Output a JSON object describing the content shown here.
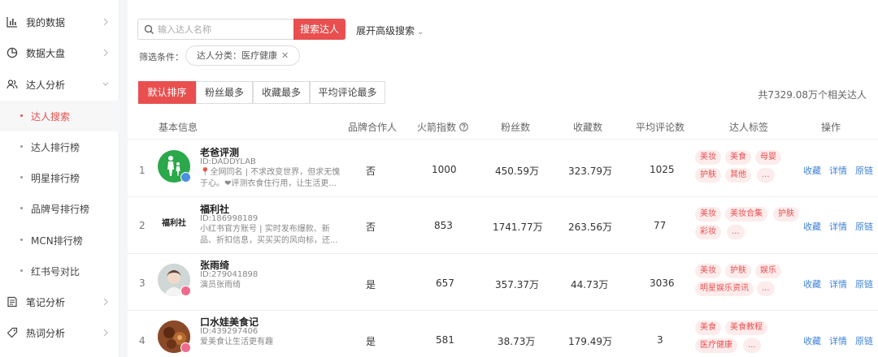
{
  "sidebar": {
    "items": [
      {
        "label": "我的数据",
        "icon": "bar-chart-icon"
      },
      {
        "label": "数据大盘",
        "icon": "pie-chart-icon"
      },
      {
        "label": "达人分析",
        "icon": "users-icon"
      },
      {
        "label": "笔记分析",
        "icon": "note-icon"
      },
      {
        "label": "热词分析",
        "icon": "tag-icon"
      }
    ],
    "sub_items": [
      {
        "label": "达人搜索",
        "active": true
      },
      {
        "label": "达人排行榜"
      },
      {
        "label": "明星排行榜"
      },
      {
        "label": "品牌号排行榜"
      },
      {
        "label": "MCN排行榜"
      },
      {
        "label": "红书号对比"
      }
    ]
  },
  "search": {
    "placeholder": "输入达人名称",
    "button": "搜索达人",
    "advanced": "展开高级搜索",
    "advanced_icon": "chevron-down-icon"
  },
  "filter": {
    "label": "筛选条件：",
    "chip": "达人分类：医疗健康",
    "chip_icon": "close-icon"
  },
  "sort_tabs": [
    "默认排序",
    "粉丝最多",
    "收藏最多",
    "平均评论最多"
  ],
  "total": "共7329.08万个相关达人",
  "table": {
    "headers": {
      "basic": "基本信息",
      "brand": "品牌合作人",
      "hot": "火箭指数",
      "fans": "粉丝数",
      "collect": "收藏数",
      "comments": "平均评论数",
      "tags": "达人标签",
      "ops": "操作"
    },
    "help_icon": "question-circle-icon",
    "actions": [
      "收藏",
      "详情",
      "原链"
    ],
    "rows": [
      {
        "index": "1",
        "name": "老爸评测",
        "id": "ID:DADDYLAB",
        "desc1": "📍全网同名 | 不求改变世界，但求无愧",
        "desc2": "于心。❤评测衣食住行用，让生活更...",
        "brand": "否",
        "hot": "1000",
        "fans": "450.59万",
        "collect": "323.79万",
        "comments": "1025",
        "tags": [
          "美妆",
          "美食",
          "母婴",
          "护肤",
          "其他",
          "..."
        ]
      },
      {
        "index": "2",
        "name": "福利社",
        "logo_text": "福利社",
        "id": "ID:186998189",
        "desc1": "小红书官方账号 | 实时发布爆款、新",
        "desc2": "品、折扣信息，买买买的风向标，还...",
        "brand": "否",
        "hot": "853",
        "fans": "1741.77万",
        "collect": "263.56万",
        "comments": "77",
        "tags": [
          "美妆",
          "美妆合集",
          "护肤",
          "彩妆",
          "..."
        ]
      },
      {
        "index": "3",
        "name": "张雨绮",
        "id": "ID:279041898",
        "desc1": "演员张雨绮",
        "desc2": "",
        "brand": "是",
        "hot": "657",
        "fans": "357.37万",
        "collect": "44.73万",
        "comments": "3036",
        "tags": [
          "美妆",
          "护肤",
          "娱乐",
          "明星娱乐资讯",
          "..."
        ]
      },
      {
        "index": "4",
        "name": "口水娃美食记",
        "id": "ID:439297406",
        "desc1": "爱美食让生活更有趣",
        "desc2": "",
        "brand": "是",
        "hot": "581",
        "fans": "38.73万",
        "collect": "179.49万",
        "comments": "3",
        "tags": [
          "美食",
          "美食教程",
          "医疗健康",
          "..."
        ]
      }
    ]
  },
  "colors": {
    "accent": "#e94f4f",
    "link": "#3e82d8",
    "tag_bg": "#fdecec"
  }
}
